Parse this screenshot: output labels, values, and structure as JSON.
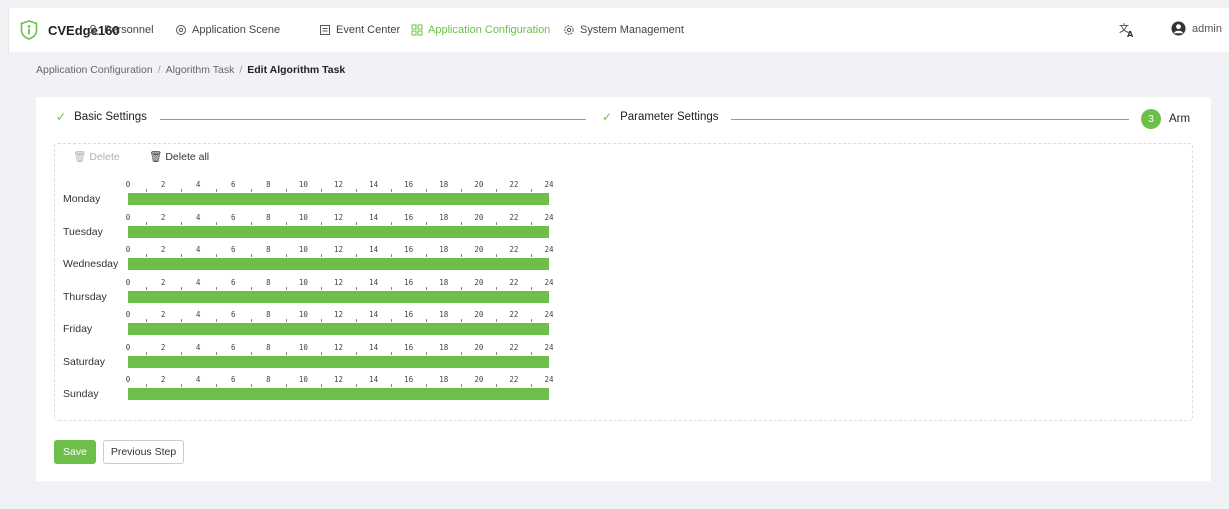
{
  "brand": "CVEdge160",
  "nav": [
    {
      "label": "Personnel",
      "icon": "person-icon",
      "active": false
    },
    {
      "label": "Application Scene",
      "icon": "scene-icon",
      "active": false
    },
    {
      "label": "Event Center",
      "icon": "event-icon",
      "active": false
    },
    {
      "label": "Application Configuration",
      "icon": "grid-icon",
      "active": true
    },
    {
      "label": "System Management",
      "icon": "gear-icon",
      "active": false
    }
  ],
  "user": {
    "name": "admin"
  },
  "breadcrumb": {
    "items": [
      "Application Configuration",
      "Algorithm Task"
    ],
    "current": "Edit Algorithm Task",
    "separator": "/"
  },
  "steps": [
    {
      "label": "Basic Settings",
      "status": "done"
    },
    {
      "label": "Parameter Settings",
      "status": "done"
    },
    {
      "label": "Arm",
      "number": "3",
      "status": "current"
    }
  ],
  "schedule": {
    "delete_label": "Delete",
    "delete_all_label": "Delete all",
    "ticks": [
      "0",
      "2",
      "4",
      "6",
      "8",
      "10",
      "12",
      "14",
      "16",
      "18",
      "20",
      "22",
      "24"
    ],
    "days": [
      {
        "name": "Monday",
        "armed_from": 0,
        "armed_to": 24
      },
      {
        "name": "Tuesday",
        "armed_from": 0,
        "armed_to": 24
      },
      {
        "name": "Wednesday",
        "armed_from": 0,
        "armed_to": 24
      },
      {
        "name": "Thursday",
        "armed_from": 0,
        "armed_to": 24
      },
      {
        "name": "Friday",
        "armed_from": 0,
        "armed_to": 24
      },
      {
        "name": "Saturday",
        "armed_from": 0,
        "armed_to": 24
      },
      {
        "name": "Sunday",
        "armed_from": 0,
        "armed_to": 24
      }
    ]
  },
  "actions": {
    "save_label": "Save",
    "previous_label": "Previous Step"
  },
  "colors": {
    "accent": "#6cc04a",
    "background": "#f0f2f5"
  }
}
